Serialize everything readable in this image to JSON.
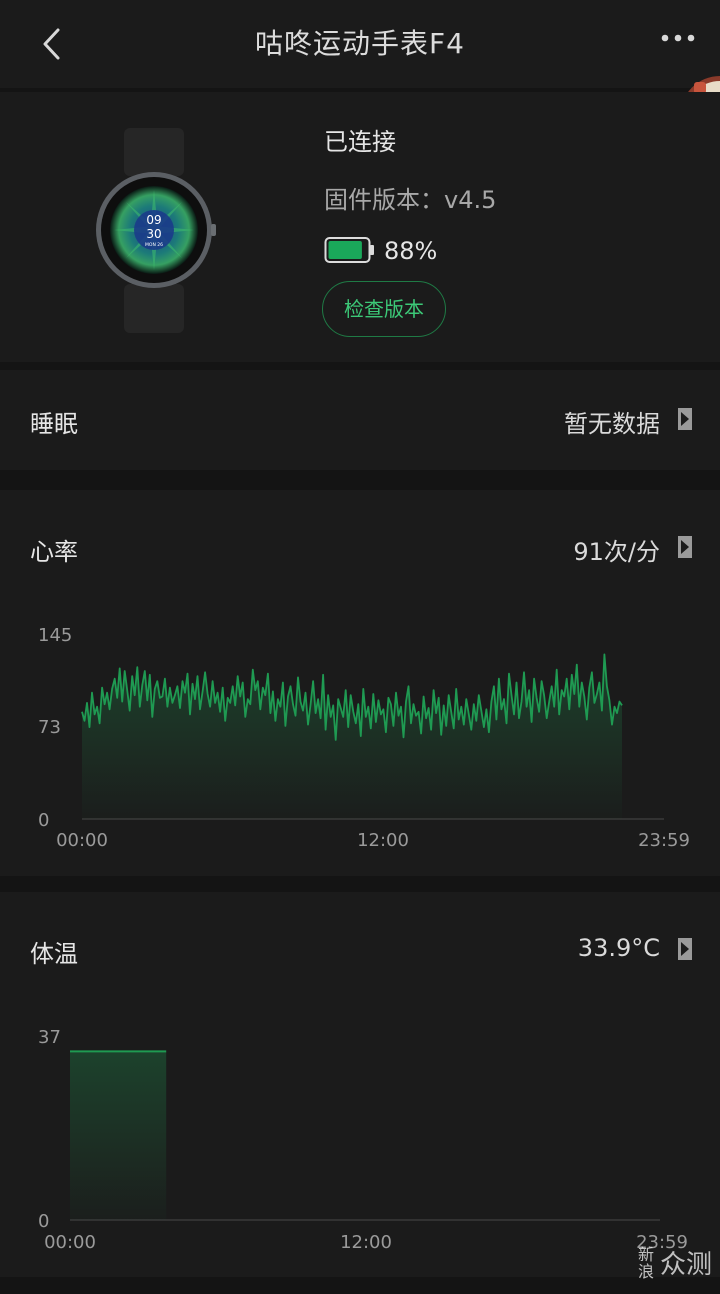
{
  "header": {
    "title": "咕咚运动手表F4",
    "back_icon": "chevron-left-icon",
    "more_icon": "more-dots-icon"
  },
  "device": {
    "status": "已连接",
    "firmware": "固件版本：v4.5",
    "battery_percent": 88,
    "battery_label": "88%",
    "check_button": "检查版本",
    "watch_time_hour": "09",
    "watch_time_minute": "30",
    "watch_date": "MON 26"
  },
  "sleep": {
    "label": "睡眠",
    "value": "暂无数据"
  },
  "heart_rate": {
    "label": "心率",
    "value": "91次/分"
  },
  "temperature": {
    "label": "体温",
    "value": "33.9°C"
  },
  "watermark": {
    "left": "新浪",
    "right": "众测"
  },
  "colors": {
    "accent": "#3cc877",
    "line": "#1f8a4c",
    "background": "#141414",
    "card": "#1b1b1b"
  },
  "chart_data": [
    {
      "type": "line",
      "ylim": [
        0,
        145
      ],
      "yticks": [
        0,
        73,
        145
      ],
      "xticks": [
        "00:00",
        "12:00",
        "23:59"
      ],
      "x_range_hours": [
        0,
        24
      ],
      "series": [
        {
          "values": [
            84,
            77,
            91,
            72,
            99,
            82,
            88,
            75,
            103,
            90,
            99,
            86,
            102,
            110,
            95,
            118,
            92,
            116,
            101,
            85,
            112,
            97,
            119,
            88,
            105,
            116,
            93,
            113,
            80,
            102,
            108,
            95,
            96,
            110,
            88,
            103,
            91,
            97,
            104,
            87,
            108,
            99,
            114,
            82,
            106,
            94,
            112,
            86,
            100,
            115,
            98,
            88,
            108,
            91,
            99,
            84,
            103,
            77,
            95,
            91,
            104,
            89,
            112,
            96,
            107,
            80,
            94,
            90,
            117,
            101,
            108,
            86,
            103,
            97,
            114,
            83,
            100,
            77,
            94,
            88,
            107,
            73,
            96,
            104,
            90,
            81,
            111,
            92,
            85,
            99,
            74,
            90,
            108,
            83,
            94,
            79,
            113,
            70,
            97,
            80,
            89,
            62,
            94,
            87,
            80,
            101,
            72,
            97,
            84,
            75,
            90,
            65,
            102,
            80,
            88,
            71,
            98,
            76,
            93,
            82,
            86,
            68,
            95,
            90,
            73,
            99,
            81,
            88,
            64,
            92,
            104,
            75,
            90,
            81,
            84,
            67,
            96,
            79,
            87,
            70,
            101,
            83,
            95,
            66,
            89,
            73,
            97,
            84,
            71,
            102,
            78,
            88,
            74,
            94,
            82,
            70,
            90,
            77,
            97,
            85,
            72,
            86,
            68,
            92,
            104,
            78,
            110,
            86,
            94,
            75,
            114,
            97,
            82,
            107,
            79,
            92,
            115,
            88,
            101,
            76,
            110,
            95,
            84,
            108,
            97,
            79,
            92,
            104,
            88,
            117,
            82,
            101,
            96,
            110,
            86,
            113,
            98,
            121,
            88,
            107,
            96,
            78,
            103,
            115,
            91,
            98,
            107,
            85,
            129,
            104,
            93,
            74,
            88,
            83,
            92,
            89
          ]
        }
      ]
    },
    {
      "type": "bar",
      "ylim": [
        0,
        37
      ],
      "yticks": [
        0,
        37
      ],
      "xticks": [
        "00:00",
        "12:00",
        "23:59"
      ],
      "x_range_hours": [
        0,
        24
      ],
      "bars": [
        {
          "x_start_hours": 0,
          "x_end_hours": 3.9,
          "value": 33.9
        }
      ]
    }
  ]
}
